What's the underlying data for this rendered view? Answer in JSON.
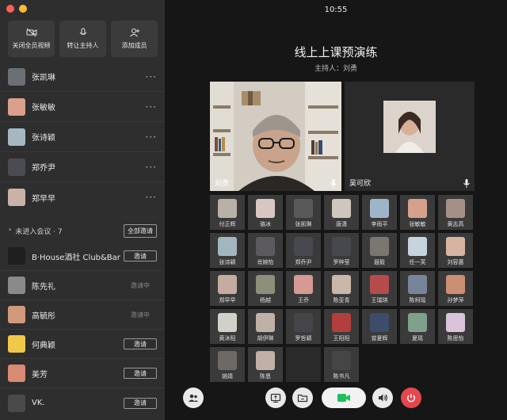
{
  "window": {
    "time": "10:55"
  },
  "sidebar": {
    "actions": [
      {
        "label": "关闭全员视频",
        "icon": "video-off-icon"
      },
      {
        "label": "转让主持人",
        "icon": "microphone-icon"
      },
      {
        "label": "添加成员",
        "icon": "add-user-icon"
      }
    ],
    "members": [
      {
        "name": "张凯琳",
        "color": "#6c6f74"
      },
      {
        "name": "张敏敏",
        "color": "#d9a08b"
      },
      {
        "name": "张诗颖",
        "color": "#a7b7c2"
      },
      {
        "name": "郑乔尹",
        "color": "#4b4b52"
      },
      {
        "name": "郑早早",
        "color": "#c9b3a8"
      }
    ],
    "more_label": "···",
    "pending_title": "未进入会议 · 7",
    "invite_all_label": "全部邀请",
    "pending": [
      {
        "name": "B·House酒社 Club&Bar",
        "status": "邀请",
        "color": "#1f1f1f"
      },
      {
        "name": "陈先礼",
        "status": "邀请中",
        "color": "#8a8a8a"
      },
      {
        "name": "高毓彤",
        "status": "邀请中",
        "color": "#d29a7c"
      },
      {
        "name": "何典颖",
        "status": "邀请",
        "color": "#f2c84b"
      },
      {
        "name": "美芳",
        "status": "邀请",
        "color": "#d98a72"
      },
      {
        "name": "VK.",
        "status": "邀请",
        "color": "#4a4a4a"
      }
    ]
  },
  "meeting": {
    "title": "线上上课预演练",
    "host_line": "主持人：刘勇",
    "host_tile_name": "刘勇",
    "other_tile_name": "吴可欣"
  },
  "grid": [
    {
      "name": "付正辉",
      "color": "#b9b0a6"
    },
    {
      "name": "骆冰",
      "color": "#d7c7c2"
    },
    {
      "name": "张凯琳",
      "color": "#59595c"
    },
    {
      "name": "唐潇",
      "color": "#cfc7bd"
    },
    {
      "name": "李雨平",
      "color": "#9fb4c8"
    },
    {
      "name": "张敏敏",
      "color": "#d6a18c"
    },
    {
      "name": "黄志高",
      "color": "#a39187"
    },
    {
      "name": "张诗颖",
      "color": "#a2b6c0"
    },
    {
      "name": "肖婉怡",
      "color": "#5c5a5f"
    },
    {
      "name": "郑乔尹",
      "color": "#48484f"
    },
    {
      "name": "罗梓莹",
      "color": "#46484d"
    },
    {
      "name": "聂毅",
      "color": "#7a7670"
    },
    {
      "name": "任一芙",
      "color": "#c7d3dd"
    },
    {
      "name": "刘容惠",
      "color": "#d7b4a1"
    },
    {
      "name": "郑早早",
      "color": "#c4ada0"
    },
    {
      "name": "杨越",
      "color": "#8d8f7a"
    },
    {
      "name": "王乔",
      "color": "#d49a93"
    },
    {
      "name": "陈亚青",
      "color": "#c9b7a9"
    },
    {
      "name": "王瑞琪",
      "color": "#b54b4b"
    },
    {
      "name": "陈柯瑶",
      "color": "#77859a"
    },
    {
      "name": "孙梦萍",
      "color": "#cb8f73"
    },
    {
      "name": "黄沐阳",
      "color": "#d2d0cb"
    },
    {
      "name": "胡伊琳",
      "color": "#bfb0a8"
    },
    {
      "name": "罗哲颖",
      "color": "#444449"
    },
    {
      "name": "王阳阳",
      "color": "#b33e3e"
    },
    {
      "name": "曾夏辉",
      "color": "#3c4d6a"
    },
    {
      "name": "夏瑶",
      "color": "#7fa08a"
    },
    {
      "name": "陈思怡",
      "color": "#d9c2da"
    },
    {
      "name": "姚婧",
      "color": "#6d6a66"
    },
    {
      "name": "陈恩",
      "color": "#c1b0a6"
    },
    {
      "name": "",
      "color": "#3a3a3a"
    },
    {
      "name": "陈书凡",
      "color": "#454545"
    }
  ],
  "toolbar": {
    "buttons": [
      "members-icon",
      "share-screen-icon",
      "folder-icon",
      "camera-icon",
      "speaker-icon",
      "power-icon"
    ]
  }
}
